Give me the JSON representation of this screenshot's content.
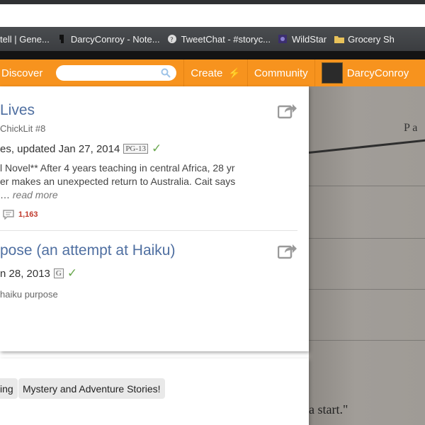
{
  "browser": {
    "bookmarks": [
      {
        "label": "tell | Gene...",
        "icon": "page-icon"
      },
      {
        "label": "DarcyConroy - Note...",
        "icon": "evernote-icon"
      },
      {
        "label": "TweetChat - #storyc...",
        "icon": "tweetchat-icon"
      },
      {
        "label": "WildStar",
        "icon": "wildstar-icon"
      },
      {
        "label": "Grocery Sh",
        "icon": "folder-icon"
      }
    ]
  },
  "nav": {
    "discover": "Discover",
    "search_placeholder": "",
    "create": "Create",
    "community": "Community",
    "username": "DarcyConroy"
  },
  "stories": [
    {
      "title": "Lives",
      "subtitle": "ChickLit #8",
      "meta": "es, updated Jan 27, 2014",
      "rating": "PG-13",
      "desc_line1": "l Novel** After 4 years teaching in central Africa, 28 yr",
      "desc_line2": "er makes an unexpected return to Australia. Cait says",
      "desc_line3_prefix": "…",
      "read_more": "read more",
      "comment_count": "1,163"
    },
    {
      "title": "pose (an attempt at Haiku)",
      "meta": "n 28, 2013",
      "rating": "G",
      "tags": "haiku purpose"
    }
  ],
  "tags": [
    {
      "label": "ing"
    },
    {
      "label": "Mystery and Adventure Stories!"
    }
  ],
  "photo": {
    "text_top": "P a",
    "text_bottom": "a start.\""
  }
}
